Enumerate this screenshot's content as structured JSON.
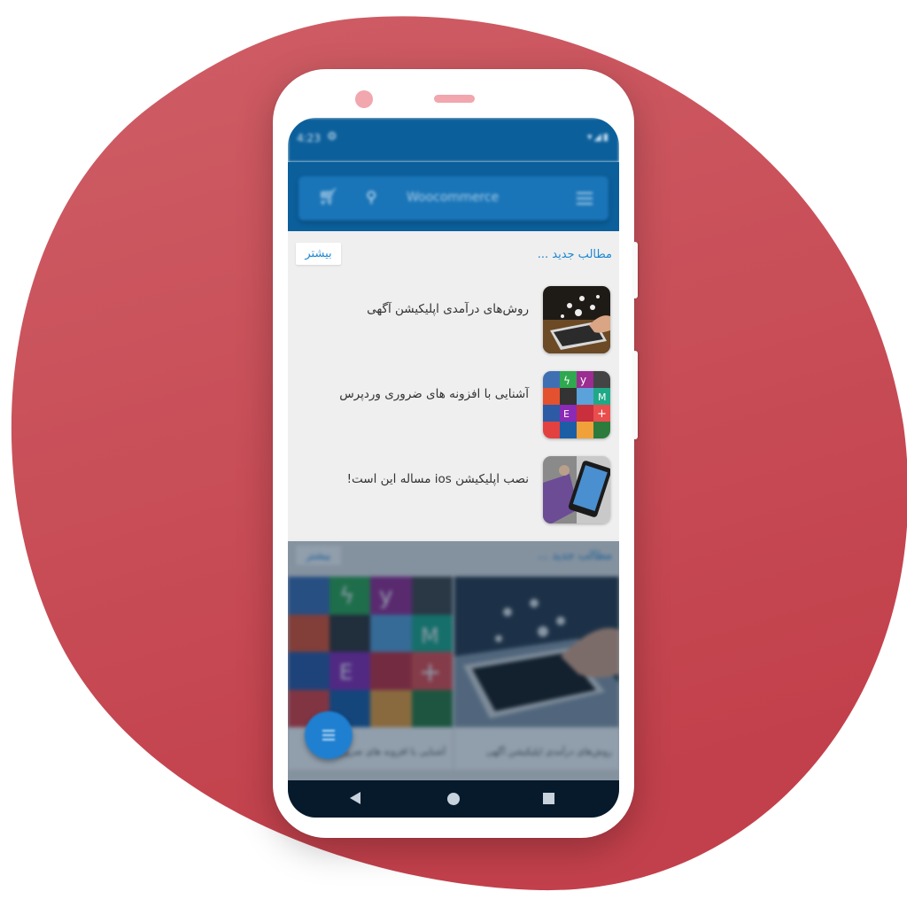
{
  "status_bar": {
    "time": "4:23"
  },
  "search": {
    "placeholder": "Woocommerce"
  },
  "section1": {
    "title": "مطالب جدید ...",
    "more_label": "بیشتر",
    "items": [
      {
        "title": "روش‌های درآمدی اپلیکیشن آگهی"
      },
      {
        "title": "آشنایی با افزونه های ضروری وردپرس"
      },
      {
        "title": "نصب اپلیکیشن ios مساله این است!"
      }
    ]
  },
  "section2": {
    "title": "مطالب جدید ...",
    "more_label": "بیشتر",
    "cards": [
      {
        "caption": "روش‌های درآمدی اپلیکیشن آگهی"
      },
      {
        "caption": "آشنایی با افزونه های ضروری..."
      }
    ]
  },
  "colors": {
    "background_blob": "#c94b55",
    "app_bar": "#0b5f9b",
    "accent": "#1e88d0"
  }
}
